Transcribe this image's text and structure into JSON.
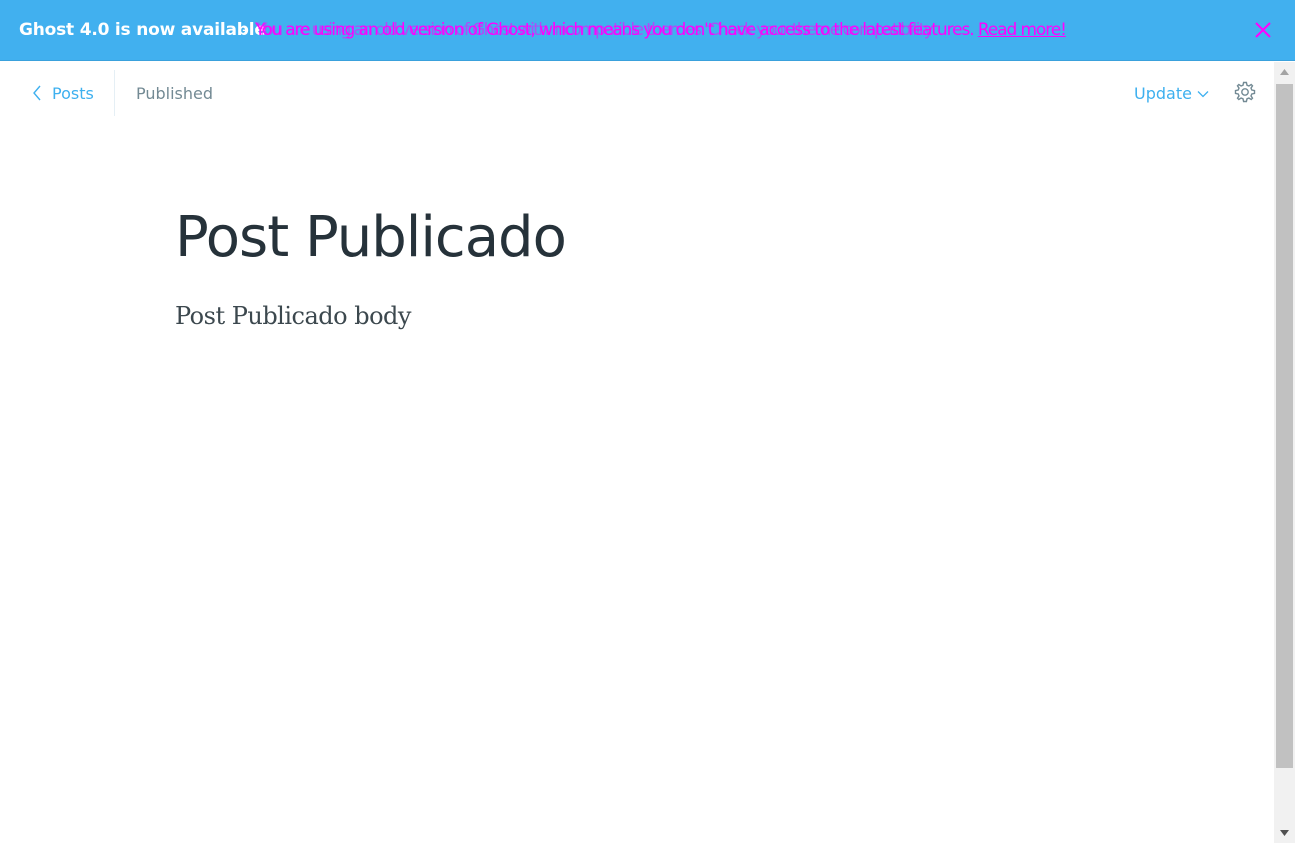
{
  "banner": {
    "title": "Ghost 4.0 is now available",
    "separator": "-",
    "message": "You are using an old version of Ghost, which means you don't have access to the latest features.",
    "link_label": "Read more!",
    "overlay_text": "You are using an old version of Ghost with incompatible themes. Check your theme compatibility",
    "text_color": "#ff00ff",
    "background_color": "#41b0ef",
    "close_icon": "close-icon"
  },
  "header": {
    "back_label": "Posts",
    "status": "Published",
    "update_label": "Update",
    "accent_color": "#3eb0ef",
    "settings_icon": "gear-icon"
  },
  "post": {
    "title": "Post Publicado",
    "body": "Post Publicado body"
  }
}
